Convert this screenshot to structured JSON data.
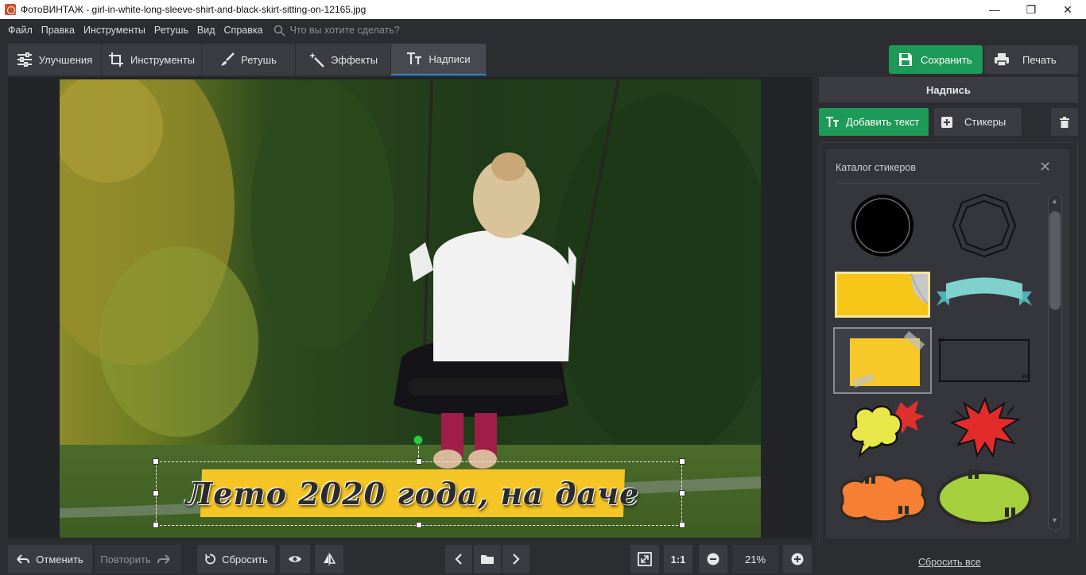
{
  "window": {
    "title": "ФотоВИНТАЖ - girl-in-white-long-sleeve-shirt-and-black-skirt-sitting-on-12165.jpg",
    "controls": [
      "—",
      "❐",
      "✕"
    ]
  },
  "menu": {
    "items": [
      "Файл",
      "Правка",
      "Инструменты",
      "Ретушь",
      "Вид",
      "Справка"
    ],
    "search_placeholder": "Что вы хотите сделать?"
  },
  "tabs": [
    {
      "label": "Улучшения",
      "icon": "sliders-icon"
    },
    {
      "label": "Инструменты",
      "icon": "crop-icon"
    },
    {
      "label": "Ретушь",
      "icon": "brush-icon"
    },
    {
      "label": "Эффекты",
      "icon": "magic-wand-icon"
    },
    {
      "label": "Надписи",
      "icon": "text-icon",
      "active": true
    }
  ],
  "actions": {
    "save": "Сохранить",
    "print": "Печать"
  },
  "canvas": {
    "caption_text": "Лето 2020 года, на даче"
  },
  "panel": {
    "header": "Надпись",
    "add_text": "Добавить текст",
    "stickers": "Стикеры",
    "catalog_title": "Каталог стикеров",
    "stickers_list": [
      {
        "name": "black-circle-sticker"
      },
      {
        "name": "octagon-outline-sticker"
      },
      {
        "name": "yellow-page-curl-sticker"
      },
      {
        "name": "teal-ribbon-sticker"
      },
      {
        "name": "yellow-taped-note-sticker",
        "selected": true
      },
      {
        "name": "quote-frame-sticker"
      },
      {
        "name": "yellow-cloud-bubble-sticker"
      },
      {
        "name": "red-burst-bubble-sticker"
      },
      {
        "name": "orange-cloud-bubble-sticker"
      },
      {
        "name": "green-oval-bubble-sticker"
      }
    ]
  },
  "bottom": {
    "undo": "Отменить",
    "redo": "Повторить",
    "reset": "Сбросить",
    "ratio": "1:1",
    "zoom": "21%",
    "reset_all": "Сбросить все"
  },
  "colors": {
    "accent_green": "#1e9a58",
    "active_tab_underline": "#2c8be0",
    "banner_yellow": "#f4c524"
  }
}
